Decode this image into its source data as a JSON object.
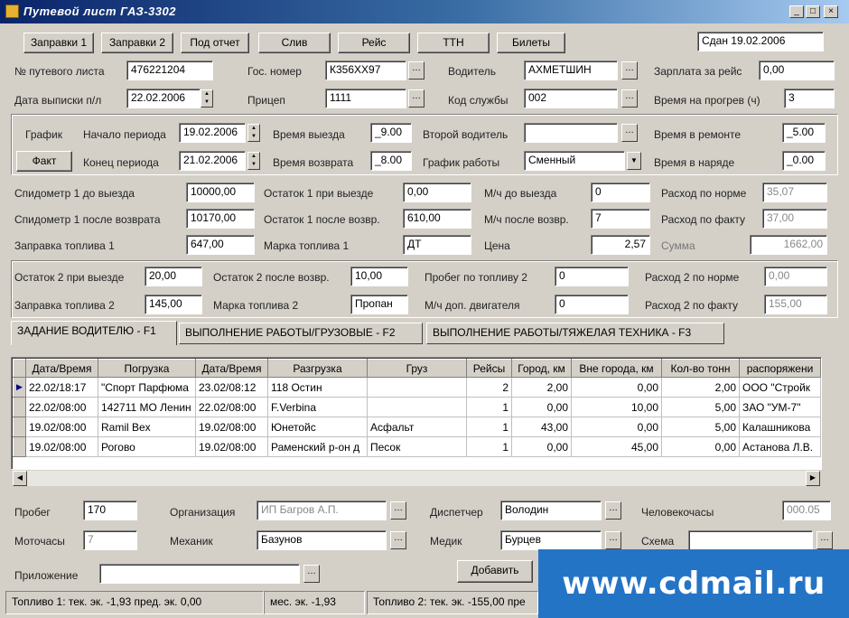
{
  "window": {
    "title": "Путевой лист   ГАЗ-3302"
  },
  "toolbar": {
    "buttons": [
      "Заправки 1",
      "Заправки 2",
      "Под отчет",
      "Слив",
      "Рейс",
      "ТТН",
      "Билеты"
    ],
    "status_field": "Сдан 19.02.2006"
  },
  "header": {
    "waybill_no_label": "№ путевого листа",
    "waybill_no": "476221204",
    "issue_date_label": "Дата выписки п/л",
    "issue_date": "22.02.2006",
    "gov_number_label": "Гос. номер",
    "gov_number": "К356ХХ97",
    "trailer_label": "Прицеп",
    "trailer": "1111",
    "driver_label": "Водитель",
    "driver": "АХМЕТШИН",
    "service_code_label": "Код службы",
    "service_code": "002",
    "salary_label": "Зарплата за рейс",
    "salary": "0,00",
    "warmup_label": "Время на прогрев (ч)",
    "warmup": "3"
  },
  "schedule": {
    "plan_label": "График",
    "fact_label": "Факт",
    "period_start_label": "Начало периода",
    "period_start": "19.02.2006",
    "period_end_label": "Конец периода",
    "period_end": "21.02.2006",
    "departure_label": "Время выезда",
    "departure": "_9.00",
    "return_label": "Время возврата",
    "return": "_8.00",
    "second_driver_label": "Второй водитель",
    "second_driver": "",
    "work_schedule_label": "График работы",
    "work_schedule": "Сменный",
    "repair_time_label": "Время в ремонте",
    "repair_time": "_5.00",
    "outfit_time_label": "Время в наряде",
    "outfit_time": "_0.00"
  },
  "fuel1": {
    "odo_before_label": "Спидометр 1 до выезда",
    "odo_before": "10000,00",
    "odo_after_label": "Спидометр 1 после возврата",
    "odo_after": "10170,00",
    "refuel_label": "Заправка топлива 1",
    "refuel": "647,00",
    "rest_out_label": "Остаток 1 при выезде",
    "rest_out": "0,00",
    "rest_back_label": "Остаток 1 после возвр.",
    "rest_back": "610,00",
    "fuel_brand_label": "Марка топлива 1",
    "fuel_brand": "ДТ",
    "mh_before_label": "М/ч до выезда",
    "mh_before": "0",
    "mh_after_label": "М/ч после возвр.",
    "mh_after": "7",
    "price_label": "Цена",
    "price": "2,57",
    "norm_label": "Расход по норме",
    "norm": "35,07",
    "fact_label": "Расход по факту",
    "fact": "37,00",
    "sum_label": "Сумма",
    "sum": "1662,00"
  },
  "fuel2": {
    "rest_out_label": "Остаток 2 при выезде",
    "rest_out": "20,00",
    "refuel_label": "Заправка топлива 2",
    "refuel": "145,00",
    "rest_back_label": "Остаток 2 после возвр.",
    "rest_back": "10,00",
    "fuel_brand_label": "Марка топлива 2",
    "fuel_brand": "Пропан",
    "mileage_label": "Пробег по топливу 2",
    "mileage": "0",
    "mh_extra_label": "М/ч доп. двигателя",
    "mh_extra": "0",
    "norm_label": "Расход 2 по норме",
    "norm": "0,00",
    "fact_label": "Расход 2 по факту",
    "fact": "155,00"
  },
  "tabs": [
    "ЗАДАНИЕ ВОДИТЕЛЮ - F1",
    "ВЫПОЛНЕНИЕ РАБОТЫ/ГРУЗОВЫЕ - F2",
    "ВЫПОЛНЕНИЕ РАБОТЫ/ТЯЖЕЛАЯ ТЕХНИКА - F3"
  ],
  "grid": {
    "columns": [
      "Дата/Время",
      "Погрузка",
      "Дата/Время",
      "Разгрузка",
      "Груз",
      "Рейсы",
      "Город, км",
      "Вне города, км",
      "Кол-во тонн",
      "распоряжени"
    ],
    "rows": [
      [
        "22.02/18:17",
        "\"Спорт Парфюма",
        "23.02/08:12",
        "118 Остин",
        "",
        "2",
        "2,00",
        "0,00",
        "2,00",
        "ООО \"Стройк"
      ],
      [
        "22.02/08:00",
        "142711 МО Ленин",
        "22.02/08:00",
        "F.Verbina",
        "",
        "1",
        "0,00",
        "10,00",
        "5,00",
        "ЗАО \"УМ-7\""
      ],
      [
        "19.02/08:00",
        "Ramil Bex",
        "19.02/08:00",
        "Юнетойс",
        "Асфальт",
        "1",
        "43,00",
        "0,00",
        "5,00",
        "Калашникова"
      ],
      [
        "19.02/08:00",
        "Рогово",
        "19.02/08:00",
        "Раменский р-он д",
        "Песок",
        "1",
        "0,00",
        "45,00",
        "0,00",
        "Астанова Л.В."
      ]
    ]
  },
  "footer": {
    "mileage_label": "Пробег",
    "mileage": "170",
    "motohours_label": "Моточасы",
    "motohours": "7",
    "attachment_label": "Приложение",
    "attachment": "",
    "org_label": "Организация",
    "org": "ИП Багров А.П.",
    "mechanic_label": "Механик",
    "mechanic": "Базунов",
    "dispatcher_label": "Диспетчер",
    "dispatcher": "Володин",
    "medic_label": "Медик",
    "medic": "Бурцев",
    "manhours_label": "Человекочасы",
    "manhours": "000.05",
    "scheme_label": "Схема",
    "scheme": "",
    "add_button": "Добавить"
  },
  "status": {
    "fuel1": "Топливо 1:  тек. эк.  -1,93    пред. эк.  0,00",
    "fuel1_month": "мес. эк.  -1,93",
    "fuel2": "Топливо 2:  тек. эк.  -155,00 пре"
  },
  "watermark": "www.cdmail.ru"
}
